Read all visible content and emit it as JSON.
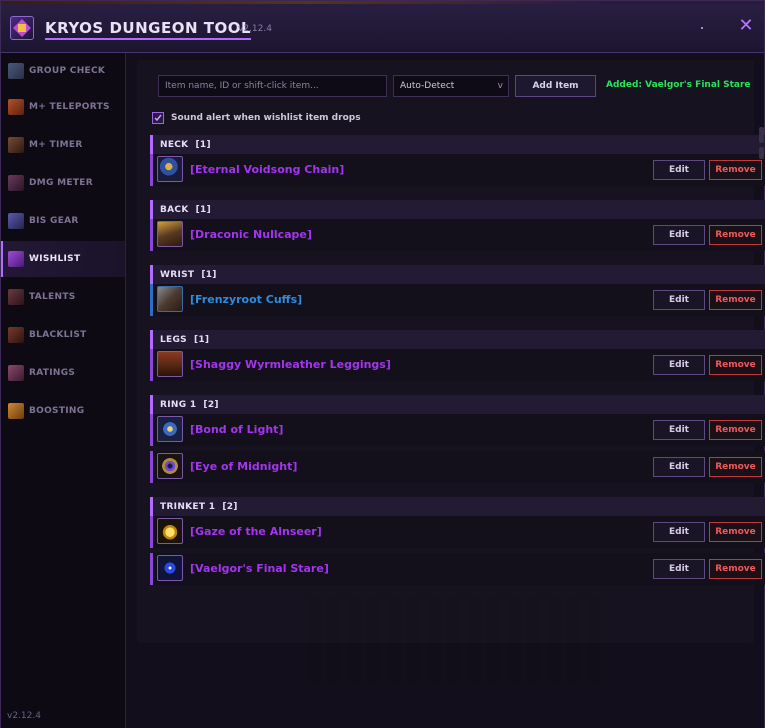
{
  "app": {
    "title": "KRYOS DUNGEON TOOL",
    "version": "v2.12.4",
    "close_icon": "close-icon",
    "accent_color": "#b26cff"
  },
  "sidebar": {
    "items": [
      {
        "label": "GROUP CHECK",
        "icon": "group-check-icon",
        "active": false
      },
      {
        "label": "M+ TELEPORTS",
        "icon": "teleport-icon",
        "active": false
      },
      {
        "label": "M+ TIMER",
        "icon": "timer-icon",
        "active": false
      },
      {
        "label": "DMG METER",
        "icon": "damage-meter-icon",
        "active": false
      },
      {
        "label": "BIS GEAR",
        "icon": "bis-gear-icon",
        "active": false
      },
      {
        "label": "WISHLIST",
        "icon": "wishlist-icon",
        "active": true
      },
      {
        "label": "TALENTS",
        "icon": "talents-icon",
        "active": false
      },
      {
        "label": "BLACKLIST",
        "icon": "blacklist-icon",
        "active": false
      },
      {
        "label": "RATINGS",
        "icon": "ratings-icon",
        "active": false
      },
      {
        "label": "BOOSTING",
        "icon": "boosting-icon",
        "active": false
      }
    ],
    "version": "v2.12.4"
  },
  "toolbar": {
    "search_placeholder": "Item name, ID or shift-click item...",
    "search_value": "",
    "detect_selected": "Auto-Detect",
    "add_button": "Add Item",
    "status": "Added: Vaelgor's Final Stare",
    "status_color": "#27e35b"
  },
  "sound_alert": {
    "label": "Sound alert when wishlist item drops",
    "checked": true
  },
  "wishlist": {
    "edit_label": "Edit",
    "remove_label": "Remove",
    "groups": [
      {
        "slot": "NECK",
        "count": "[1]",
        "items": [
          {
            "name": "[Eternal Voidsong Chain]",
            "quality": "epic",
            "icon": "necklace-icon"
          }
        ]
      },
      {
        "slot": "BACK",
        "count": "[1]",
        "items": [
          {
            "name": "[Draconic Nullcape]",
            "quality": "epic",
            "icon": "cloak-icon"
          }
        ]
      },
      {
        "slot": "WRIST",
        "count": "[1]",
        "items": [
          {
            "name": "[Frenzyroot Cuffs]",
            "quality": "rare",
            "icon": "bracers-icon"
          }
        ]
      },
      {
        "slot": "LEGS",
        "count": "[1]",
        "items": [
          {
            "name": "[Shaggy Wyrmleather Leggings]",
            "quality": "epic",
            "icon": "leggings-icon"
          }
        ]
      },
      {
        "slot": "RING 1",
        "count": "[2]",
        "items": [
          {
            "name": "[Bond of Light]",
            "quality": "epic",
            "icon": "ring-icon"
          },
          {
            "name": "[Eye of Midnight]",
            "quality": "epic",
            "icon": "ring-eye-icon"
          }
        ]
      },
      {
        "slot": "TRINKET 1",
        "count": "[2]",
        "items": [
          {
            "name": "[Gaze of the Alnseer]",
            "quality": "epic",
            "icon": "trinket-orb-icon"
          },
          {
            "name": "[Vaelgor's Final Stare]",
            "quality": "epic",
            "icon": "trinket-eye-icon"
          }
        ]
      }
    ]
  }
}
